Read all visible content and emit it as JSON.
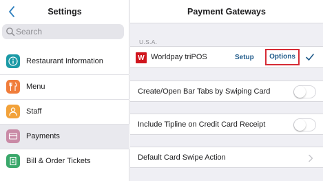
{
  "left_pane": {
    "title": "Settings",
    "search": {
      "placeholder": "Search"
    },
    "menu_items": [
      {
        "label": "Restaurant Information",
        "icon": "info-icon",
        "color": "#1b9aa6"
      },
      {
        "label": "Menu",
        "icon": "utensils-icon",
        "color": "#f07d3b"
      },
      {
        "label": "Staff",
        "icon": "person-icon",
        "color": "#f2a23a"
      },
      {
        "label": "Payments",
        "icon": "credit-card-icon",
        "color": "#c98aa6",
        "selected": true
      },
      {
        "label": "Bill & Order Tickets",
        "icon": "ticket-icon",
        "color": "#3aa86b"
      }
    ]
  },
  "right_pane": {
    "title": "Payment Gateways",
    "section_label": "U.S.A.",
    "gateway": {
      "logo_letter": "W",
      "name": "Worldpay triPOS",
      "setup_label": "Setup",
      "options_label": "Options",
      "selected": true
    },
    "rows": [
      {
        "label": "Create/Open Bar Tabs by Swiping Card",
        "type": "toggle",
        "value": false
      },
      {
        "label": "Include Tipline on Credit Card Receipt",
        "type": "toggle",
        "value": false
      },
      {
        "label": "Default Card Swipe Action",
        "type": "disclosure"
      }
    ]
  },
  "colors": {
    "accent_blue": "#2e7fbf",
    "link_blue": "#1f5a8a",
    "highlight_red": "#d62b35",
    "worldpay_red": "#d0161e"
  }
}
